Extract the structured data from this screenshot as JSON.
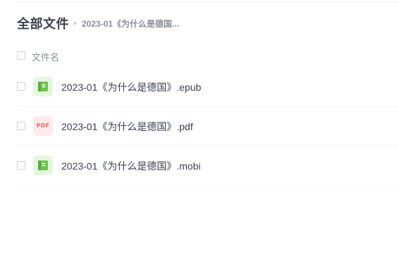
{
  "breadcrumb": {
    "root": "全部文件",
    "current": "2023-01《为什么是德国..."
  },
  "list": {
    "header_label": "文件名",
    "files": [
      {
        "name": "2023-01《为什么是德国》.epub",
        "icon": "book-icon"
      },
      {
        "name": "2023-01《为什么是德国》.pdf",
        "icon": "pdf-icon",
        "icon_text": "PDF"
      },
      {
        "name": "2023-01《为什么是德国》.mobi",
        "icon": "book-icon"
      }
    ]
  },
  "colors": {
    "book_icon": "#6cc44a",
    "book_icon_bg": "#e6f6df",
    "pdf_icon": "#f06b72",
    "pdf_icon_bg": "#fdebec",
    "title_text": "#3b4150",
    "muted_text": "#8a8f99"
  }
}
